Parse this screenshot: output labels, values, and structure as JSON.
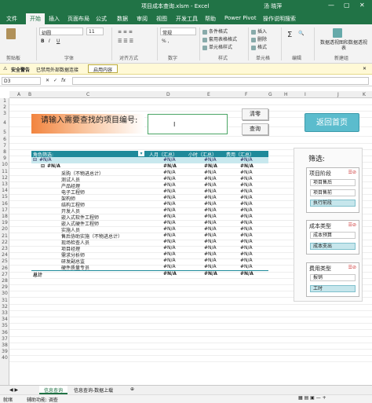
{
  "window": {
    "title": "项目成本查询.xlsm - Excel",
    "user": "汤 晓萍"
  },
  "tabs": [
    "文件",
    "开始",
    "插入",
    "页面布局",
    "公式",
    "数据",
    "审阅",
    "视图",
    "开发工具",
    "帮助",
    "Power Pivot",
    "操作说明搜索"
  ],
  "ribbon": {
    "font_name": "幼圆",
    "font_size": "11",
    "number_format": "常规",
    "conditional_format": "条件格式",
    "table_format": "套用表格格式",
    "cell_style": "单元格样式",
    "insert": "插入",
    "delete": "删除",
    "format": "格式",
    "pivot_wizard": "数据透视图和数据透视表",
    "groups": [
      "剪贴板",
      "字体",
      "对齐方式",
      "数字",
      "样式",
      "单元格",
      "编辑",
      "新建组"
    ]
  },
  "security": {
    "label": "安全警告",
    "message": "已禁用外部数据连接",
    "button": "启用内容"
  },
  "formula": {
    "name_box": "D3"
  },
  "columns": [
    "A",
    "B",
    "C",
    "D",
    "E",
    "F",
    "G",
    "H",
    "I",
    "J",
    "K"
  ],
  "rows": [
    "1",
    "2",
    "3",
    "4",
    "5",
    "6",
    "7",
    "8",
    "9",
    "10",
    "11",
    "12",
    "13",
    "14",
    "15",
    "16",
    "17",
    "18",
    "19",
    "20",
    "21",
    "22",
    "23",
    "24",
    "25",
    "26",
    "27",
    "28",
    "29",
    "30",
    "31",
    "32",
    "33",
    "34",
    "35",
    "36",
    "37",
    "38",
    "39",
    "40"
  ],
  "search": {
    "prompt": "请输入需要查找的项目编号:",
    "clear_button": "清零",
    "query_button": "查询",
    "home_button": "返回首页"
  },
  "pivot": {
    "row_header": "角色筛选:",
    "col_headers": [
      "人月（汇总）",
      "小时（汇总）",
      "费用（汇总）"
    ],
    "group_label": "#N/A",
    "na": "#N/A",
    "roles": [
      "采购（不物进总计）",
      "测试人员",
      "产品经理",
      "电子工程师",
      "架构师",
      "结构工程师",
      "开发人员",
      "嵌入式软件工程师",
      "嵌入式硬件工程师",
      "实施人员",
      "售后协助实施（不物进总计）",
      "现场检查人员",
      "项目经理",
      "需求分析师",
      "研发副总监",
      "硬件质量专员"
    ],
    "total_label": "总计"
  },
  "slicers": {
    "panel_title": "筛选:",
    "phase": {
      "title": "项目阶段",
      "items": [
        "项目售后",
        "项目售前",
        "执行前段"
      ]
    },
    "cost_type": {
      "title": "成本类型",
      "items": [
        "成本预算",
        "成本支出"
      ]
    },
    "fee_type": {
      "title": "费用类型",
      "items": [
        "报销",
        "工时"
      ]
    }
  },
  "sheet_tabs": [
    "信息查询",
    "信息查询-数据上载"
  ],
  "status": {
    "ready": "就绪",
    "accessibility": "辅助功能: 调查"
  },
  "colors": {
    "excel_green": "#217346",
    "teal": "#1f8a9a",
    "orange": "#f2843f",
    "home_button": "#5bbccd"
  }
}
